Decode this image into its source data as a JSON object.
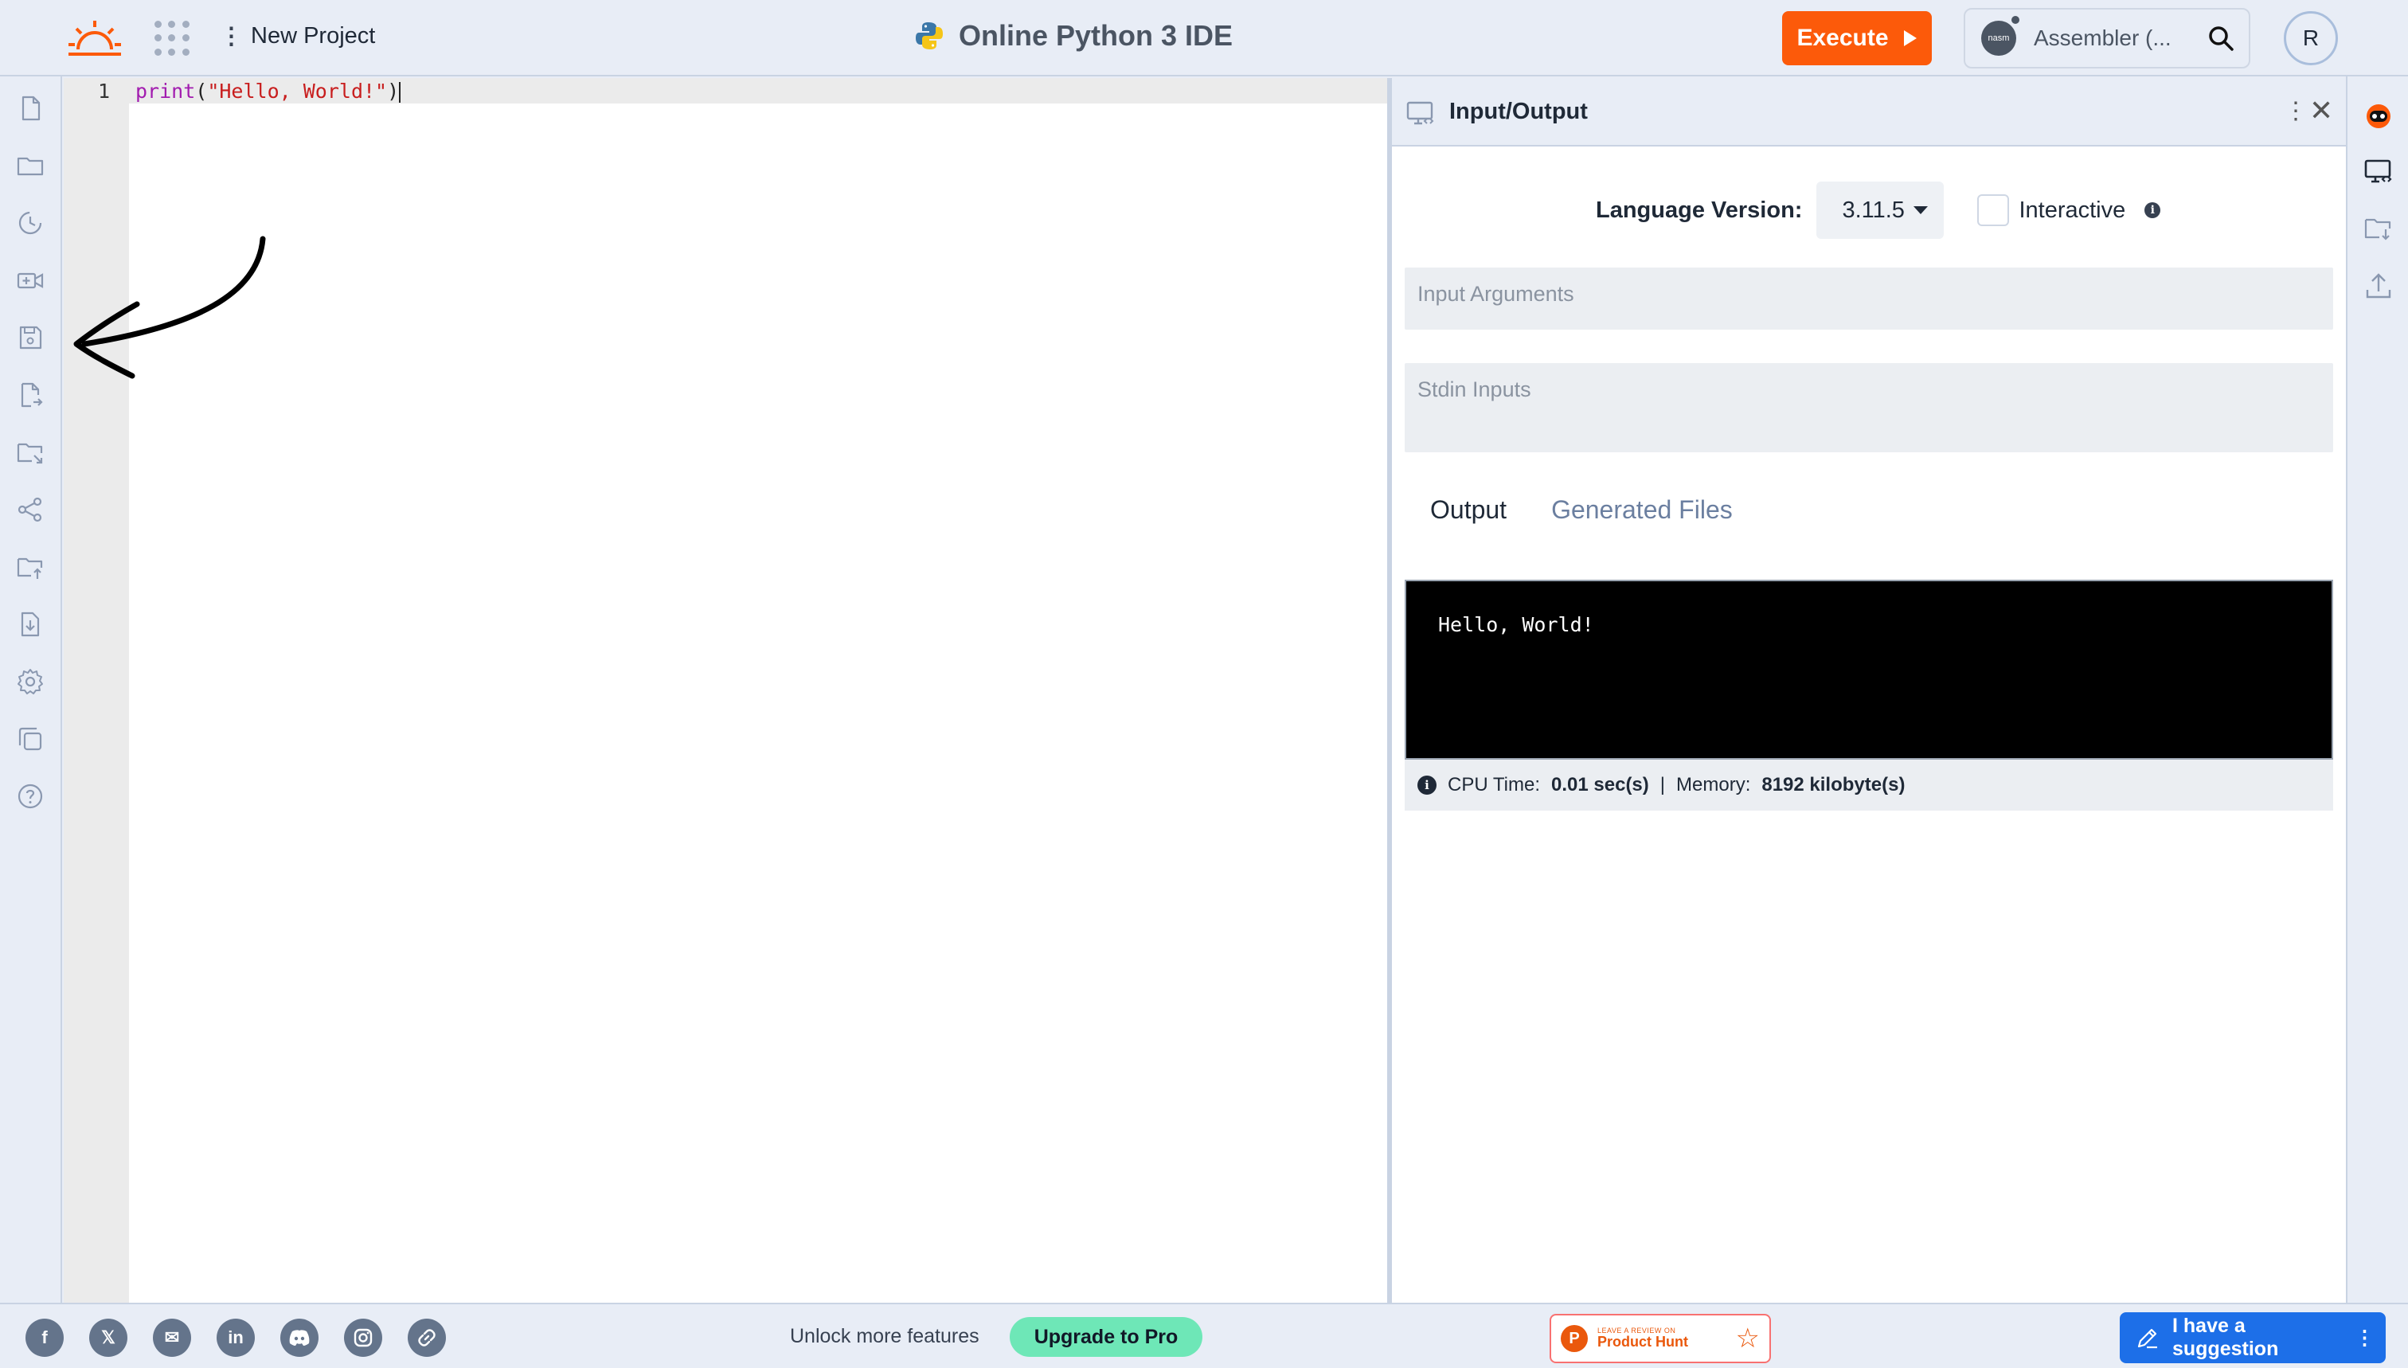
{
  "header": {
    "project_label": "New Project",
    "title": "Online Python 3 IDE",
    "execute_label": "Execute",
    "language_search_label": "Assembler (...",
    "language_badge": "nasm",
    "avatar_initial": "R",
    "accent_color": "#fc5a0a"
  },
  "left_rail": {
    "icons": [
      "new-file-icon",
      "open-folder-icon",
      "history-icon",
      "video-icon",
      "save-icon",
      "save-as-icon",
      "move-folder-icon",
      "share-icon",
      "upload-folder-icon",
      "download-icon",
      "settings-icon",
      "copy-icon",
      "help-icon"
    ]
  },
  "editor": {
    "line_number": "1",
    "code_keyword": "print",
    "code_open": "(",
    "code_string": "\"Hello, World!\"",
    "code_close": ")"
  },
  "io_panel": {
    "title": "Input/Output",
    "language_version_label": "Language Version:",
    "language_version_value": "3.11.5",
    "interactive_label": "Interactive",
    "input_arguments_placeholder": "Input Arguments",
    "stdin_placeholder": "Stdin Inputs",
    "tabs": [
      "Output",
      "Generated Files"
    ],
    "output_text": "Hello, World!",
    "cpu_label": "CPU Time:",
    "cpu_value": "0.01 sec(s)",
    "separator": "|",
    "memory_label": "Memory:",
    "memory_value": "8192 kilobyte(s)"
  },
  "right_rail": {
    "icons": [
      "bot-icon",
      "monitor-code-icon",
      "folder-download-icon",
      "upload-icon"
    ]
  },
  "footer": {
    "social_icons": [
      "facebook-icon",
      "x-icon",
      "email-icon",
      "linkedin-icon",
      "discord-icon",
      "instagram-icon",
      "link-icon"
    ],
    "unlock_text": "Unlock more features",
    "upgrade_label": "Upgrade to Pro",
    "product_hunt_small": "LEAVE A REVIEW ON",
    "product_hunt_label": "Product Hunt",
    "suggestion_label": "I have a suggestion"
  }
}
